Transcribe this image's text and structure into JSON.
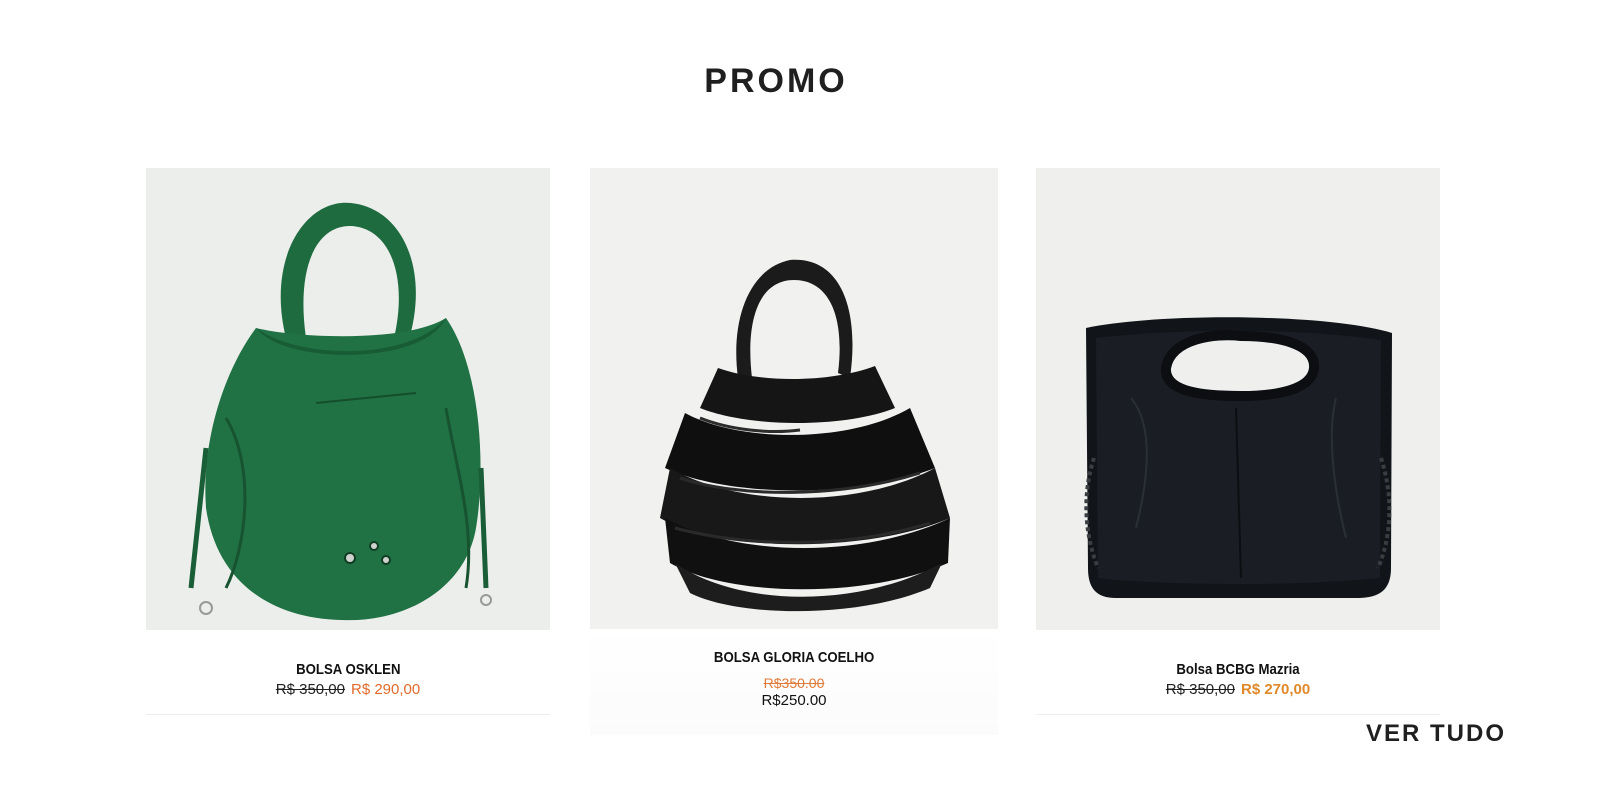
{
  "section": {
    "title": "PROMO"
  },
  "products": [
    {
      "name": "BOLSA OSKLEN",
      "old_price": "R$ 350,00",
      "new_price": "R$ 290,00",
      "image": "green-tote-bag"
    },
    {
      "name": "BOLSA GLORIA COELHO",
      "old_price": "R$350.00",
      "new_price": "R$250.00",
      "image": "black-ruffle-bag"
    },
    {
      "name": "Bolsa BCBG Mazria",
      "old_price": "R$ 350,00",
      "new_price": "R$ 270,00",
      "image": "black-leather-clutch"
    }
  ],
  "footer": {
    "view_all_label": "VER TUDO"
  },
  "colors": {
    "sale_price": "#e06a2a",
    "image_bg": "#eff0ee"
  }
}
